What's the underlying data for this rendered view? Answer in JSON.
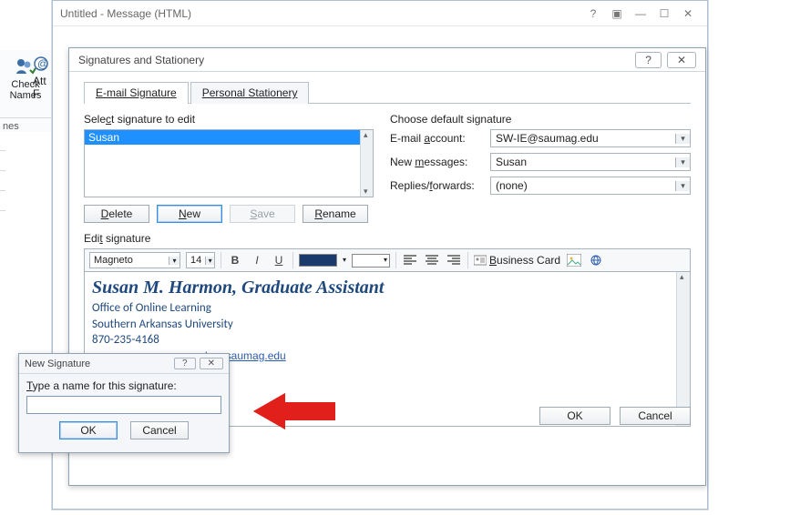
{
  "main_window": {
    "title": "Untitled - Message (HTML)"
  },
  "ribbon": {
    "check_names": "Check Names",
    "att": "Att",
    "f": "F",
    "group_label": "nes"
  },
  "dialog": {
    "title": "Signatures and Stationery",
    "tabs": {
      "email_sig": "E-mail Signature",
      "stationery": "Personal Stationery"
    },
    "select_label": "Select signature to edit",
    "list_item": "Susan",
    "buttons": {
      "delete": "Delete",
      "new": "New",
      "save": "Save",
      "rename": "Rename"
    },
    "defaults": {
      "header": "Choose default signature",
      "account_label": "E-mail account:",
      "account_value": "SW-IE@saumag.edu",
      "newmsg_label": "New messages:",
      "newmsg_value": "Susan",
      "replies_label": "Replies/forwards:",
      "replies_value": "(none)"
    },
    "edit_label": "Edit signature",
    "toolbar": {
      "font": "Magneto",
      "size": "14",
      "bizcard": "Business Card"
    },
    "signature": {
      "name_line": "Susan M. Harmon, Graduate Assistant",
      "line2": "Office of Online Learning",
      "line3": "Southern Arkansas University",
      "line4": "870-235-4168",
      "link_fragment": "ders.saumag.edu"
    },
    "footer": {
      "ok": "OK",
      "cancel": "Cancel"
    }
  },
  "newsig": {
    "title": "New Signature",
    "label": "Type a name for this signature:",
    "ok": "OK",
    "cancel": "Cancel"
  }
}
